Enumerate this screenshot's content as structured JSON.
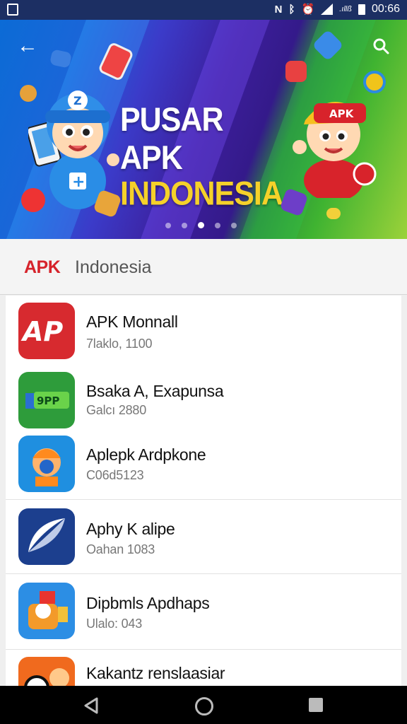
{
  "status_bar": {
    "time": "00:66",
    "net": ".ıllß"
  },
  "banner": {
    "title_line1": "PUSAR APK",
    "title_line2": "INDONESIA",
    "mascot_cap_text": "APK",
    "slide_count": 5,
    "active_slide": 2
  },
  "section": {
    "brand": "APK",
    "rest": "Indonesia"
  },
  "apps": [
    {
      "name": "APK Monnall",
      "sub": "7laklo, 1100",
      "icon": "apk-red-logo-icon",
      "icon_text": "AP"
    },
    {
      "name": "Bsaka A, Exapunsa",
      "sub": "Galcı 2880",
      "icon": "green-9pp-icon",
      "icon_text": "9PP"
    },
    {
      "name": "Aplepk Ardpkone",
      "sub": "C06d5123",
      "icon": "mascot-blue-icon"
    },
    {
      "name": "Aphy K alipe",
      "sub": "Oahan 1083",
      "icon": "navy-swoosh-icon"
    },
    {
      "name": "Dipbmls Apdhaps",
      "sub": "Ulalo: 043",
      "icon": "mascot-orange-icon"
    },
    {
      "name": "Kakantz renslaasiar",
      "sub": "",
      "icon": "orange-face-icon"
    }
  ],
  "colors": {
    "status_bar": "#1c2f63",
    "brand_red": "#d6232b",
    "title_yellow": "#f5d12a"
  }
}
